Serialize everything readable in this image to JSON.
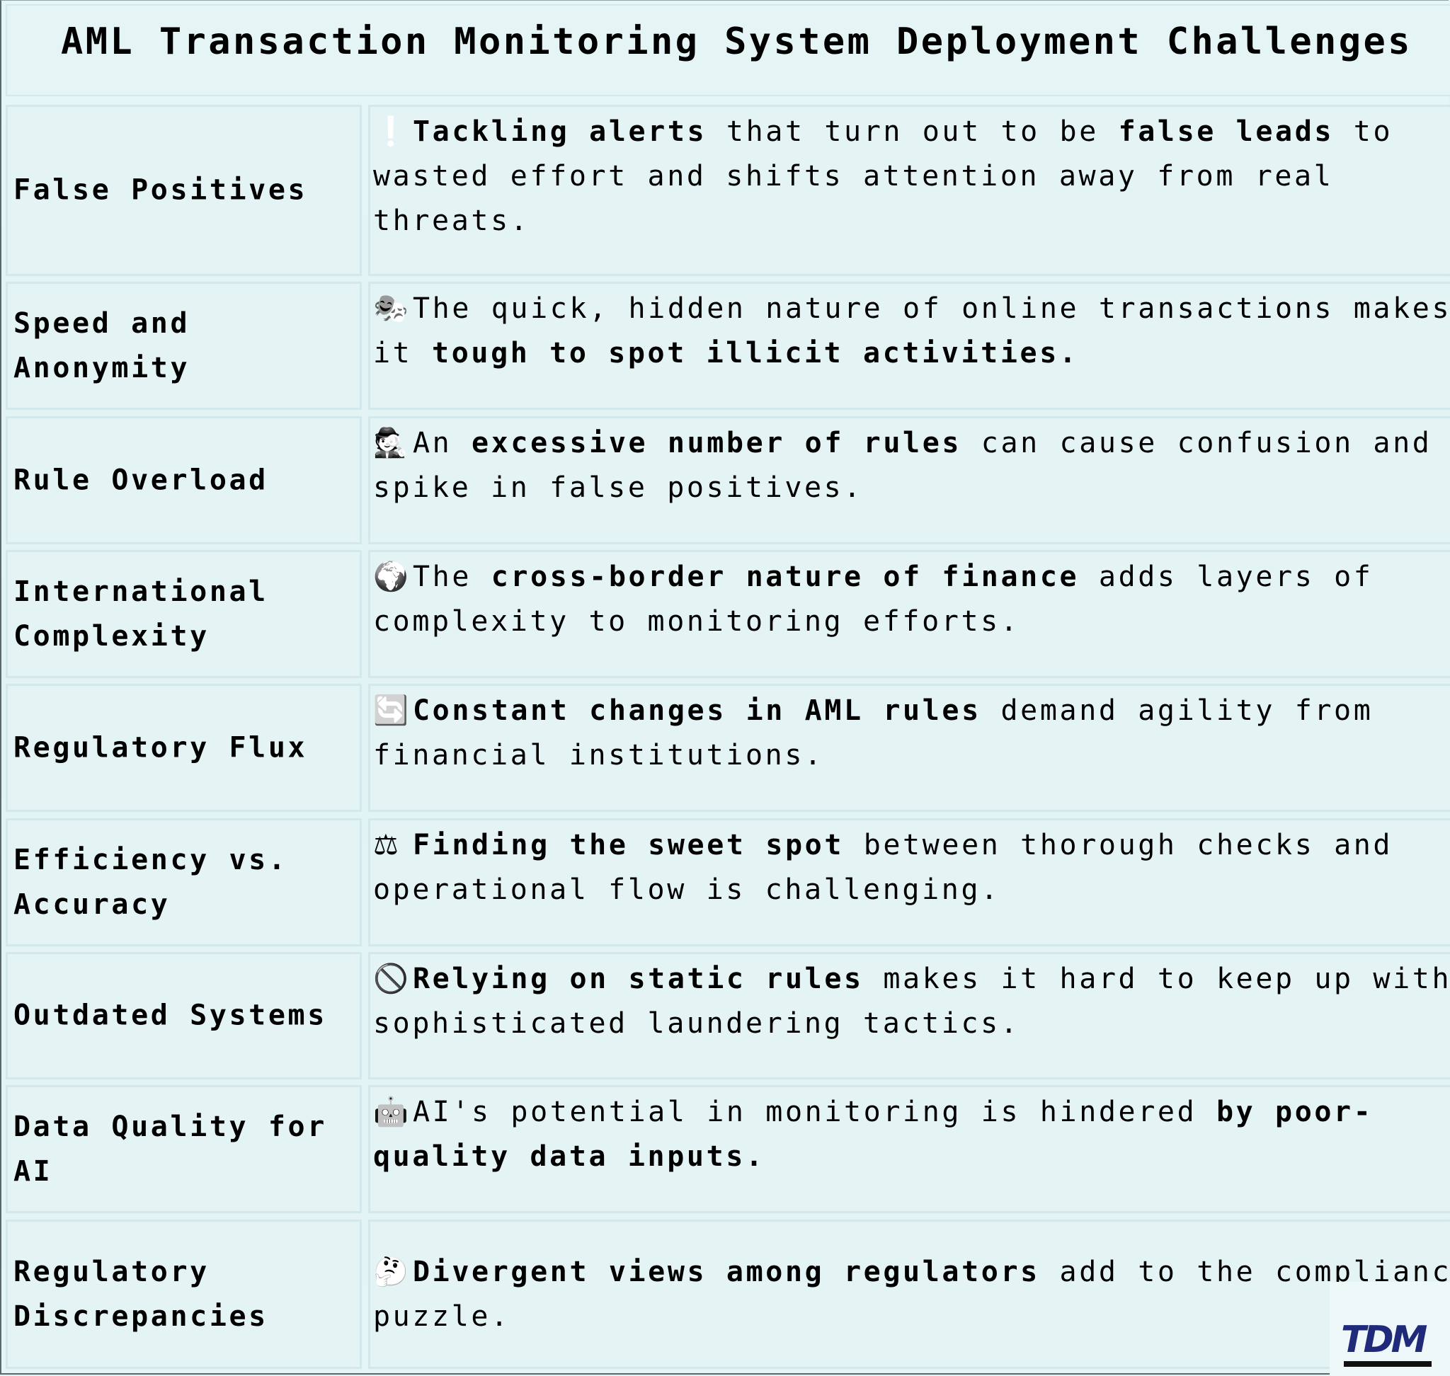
{
  "title": "AML Transaction Monitoring System Deployment Challenges",
  "rows": [
    {
      "challenge": "False Positives",
      "icon": "exclamation-icon",
      "glyph": "❕",
      "desc": [
        {
          "t": "Tackling alerts",
          "b": true
        },
        {
          "t": " that turn out to be ",
          "b": false
        },
        {
          "t": "false leads",
          "b": true
        },
        {
          "t": " to wasted effort and shifts attention away from real threats.",
          "b": false
        }
      ]
    },
    {
      "challenge": "Speed and Anonymity",
      "icon": "performing-arts-masks-icon",
      "glyph": "🎭",
      "desc": [
        {
          "t": "The quick, hidden nature of online transactions makes it ",
          "b": false
        },
        {
          "t": "tough to spot illicit activities.",
          "b": true
        }
      ]
    },
    {
      "challenge": "Rule Overload",
      "icon": "detective-icon",
      "glyph": "🕵",
      "desc": [
        {
          "t": "An ",
          "b": false
        },
        {
          "t": "excessive number of rules",
          "b": true
        },
        {
          "t": " can cause confusion and a spike in false positives.",
          "b": false
        }
      ]
    },
    {
      "challenge": "International Complexity",
      "icon": "globe-icon",
      "glyph": "🌍",
      "desc": [
        {
          "t": "The ",
          "b": false
        },
        {
          "t": "cross-border nature of finance",
          "b": true
        },
        {
          "t": " adds layers of complexity to monitoring efforts.",
          "b": false
        }
      ]
    },
    {
      "challenge": "Regulatory Flux",
      "icon": "refresh-arrows-icon",
      "glyph": "🔄",
      "desc": [
        {
          "t": "Constant changes in AML rules",
          "b": true
        },
        {
          "t": " demand agility from financial institutions.",
          "b": false
        }
      ]
    },
    {
      "challenge": "Efficiency vs. Accuracy",
      "icon": "balance-scale-icon",
      "glyph": "⚖",
      "desc": [
        {
          "t": "Finding the sweet spot",
          "b": true
        },
        {
          "t": " between thorough checks and operational flow is challenging.",
          "b": false
        }
      ]
    },
    {
      "challenge": "Outdated Systems",
      "icon": "prohibited-icon",
      "glyph": "🚫",
      "desc": [
        {
          "t": "Relying on static rules",
          "b": true
        },
        {
          "t": " makes it hard to keep up with sophisticated laundering tactics.",
          "b": false
        }
      ]
    },
    {
      "challenge": "Data Quality for AI",
      "icon": "robot-icon",
      "glyph": "🤖",
      "desc": [
        {
          "t": "AI's potential in monitoring is hindered ",
          "b": false
        },
        {
          "t": "by poor-quality data inputs.",
          "b": true
        }
      ]
    },
    {
      "challenge": "Regulatory Discrepancies",
      "icon": "thinking-face-icon",
      "glyph": "🤔",
      "desc": [
        {
          "t": "Divergent views among regulators",
          "b": true
        },
        {
          "t": " add to the compliance puzzle.",
          "b": false
        }
      ]
    }
  ],
  "logo": {
    "text": "TDM"
  }
}
